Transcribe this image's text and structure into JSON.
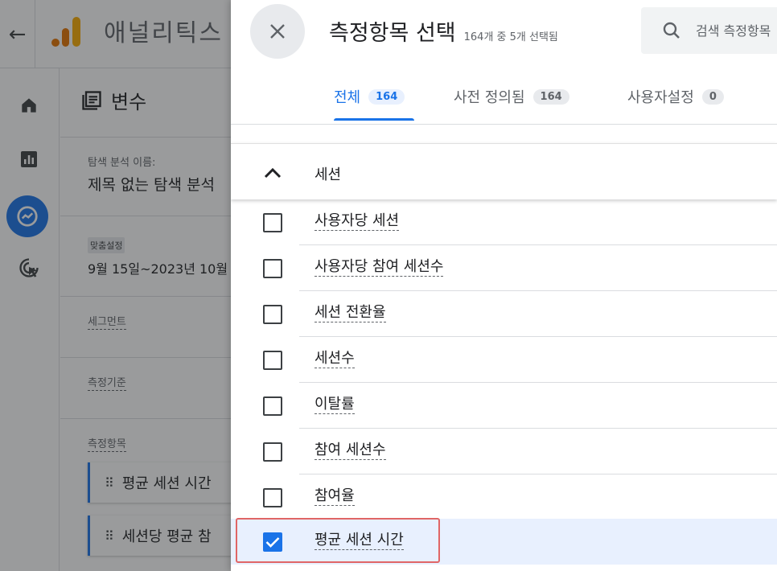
{
  "app": {
    "title": "애널리틱스",
    "back_icon": "arrow-left-icon",
    "logo_colors": [
      "#f9ab00",
      "#e37400"
    ]
  },
  "variables_panel": {
    "title": "변수",
    "exploration_name_label": "탐색 분석 이름:",
    "exploration_name_value": "제목 없는 탐색 분석",
    "date_chip": "맞춤설정",
    "date_range": "9월 15일~2023년 10월",
    "segments_label": "세그먼트",
    "dimensions_label": "측정기준",
    "metrics_label": "측정항목",
    "metric_chips": [
      "평균 세션 시간",
      "세션당 평균 참"
    ]
  },
  "drawer": {
    "title": "측정항목 선택",
    "subtitle": "164개 중 5개 선택됨",
    "search_placeholder": "검색 측정항목",
    "tabs": [
      {
        "label": "전체",
        "count": "164",
        "active": true
      },
      {
        "label": "사전 정의됨",
        "count": "164",
        "active": false
      },
      {
        "label": "사용자설정",
        "count": "0",
        "active": false
      }
    ],
    "group": {
      "label": "세션",
      "expanded": true
    },
    "metrics": [
      {
        "label": "사용자당 세션",
        "checked": false
      },
      {
        "label": "사용자당 참여 세션수",
        "checked": false
      },
      {
        "label": "세션 전환율",
        "checked": false
      },
      {
        "label": "세션수",
        "checked": false
      },
      {
        "label": "이탈률",
        "checked": false
      },
      {
        "label": "참여 세션수",
        "checked": false
      },
      {
        "label": "참여율",
        "checked": false
      },
      {
        "label": "평균 세션 시간",
        "checked": true
      }
    ]
  },
  "colors": {
    "accent": "#1a73e8",
    "highlight": "#e06666",
    "selected_row": "#e8f0fe"
  }
}
